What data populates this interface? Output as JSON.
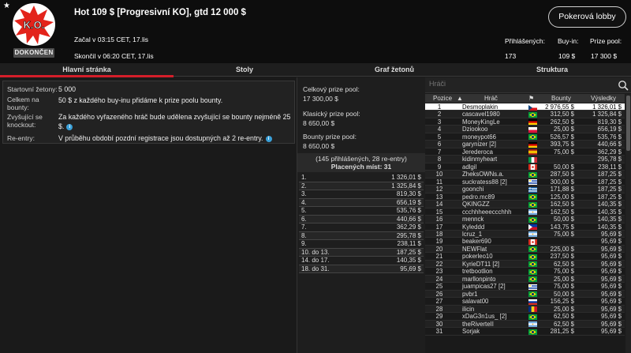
{
  "header": {
    "star": "★",
    "logo_text": "K.O.",
    "status_badge": "DOKONČEN",
    "title": "Hot 109 $ [Progresivní KO], gtd 12 000 $",
    "started": "Začal v 03:15 CET, 17.lis",
    "ended": "Skončil v 06:20 CET, 17.lis",
    "lobby_button": "Pokerová lobby",
    "stats": {
      "entries_label": "Přihlášených:",
      "entries_value": "173",
      "buyin_label": "Buy-in:",
      "buyin_value": "109 $",
      "prize_label": "Prize pool:",
      "prize_value": "17 300 $"
    }
  },
  "tabs": [
    "Hlavní stránka",
    "Stoly",
    "Graf žetonů",
    "Struktura"
  ],
  "active_tab": "Hlavní stránka",
  "colors": {
    "accent": "#d41e2a",
    "info": "#3aa0d8",
    "highlight_row": "#ffffff"
  },
  "info": {
    "starting_chips_label": "Startovní žetony:",
    "starting_chips_value": "5 000",
    "total_bounties_label": "Celkem na bounty:",
    "total_bounties_value": "50 $ z každého buy-inu přidáme k prize poolu bounty.",
    "progressive_label": "Zvyšující se knockout:",
    "progressive_value": "Za každého vyřazeného hráč bude udělena zvyšující se bounty nejméně 25 $.",
    "reentry_label": "Re-entry:",
    "reentry_value": "V průběhu období pozdní registrace jsou dostupných až 2 re-entry."
  },
  "prize_pool": {
    "total_label": "Celkový prize pool:",
    "total_value": "17 300,00 $",
    "classic_label": "Klasický prize pool:",
    "classic_value": "8 650,00 $",
    "bounty_label": "Bounty prize pool:",
    "bounty_value": "8 650,00 $",
    "summary_line": "(145 přihlášených, 28 re-entry)",
    "paid_places": "Placených míst: 31",
    "places": [
      {
        "place": "1.",
        "prize": "1 326,01 $"
      },
      {
        "place": "2.",
        "prize": "1 325,84 $"
      },
      {
        "place": "3.",
        "prize": "819,30 $"
      },
      {
        "place": "4.",
        "prize": "656,19 $"
      },
      {
        "place": "5.",
        "prize": "535,76 $"
      },
      {
        "place": "6.",
        "prize": "440,66 $"
      },
      {
        "place": "7.",
        "prize": "362,29 $"
      },
      {
        "place": "8.",
        "prize": "295,78 $"
      },
      {
        "place": "9.",
        "prize": "238,11 $"
      },
      {
        "place": "10. do 13.",
        "prize": "187,25 $"
      },
      {
        "place": "14. do 17.",
        "prize": "140,35 $"
      },
      {
        "place": "18. do 31.",
        "prize": "95,69 $"
      }
    ]
  },
  "players": {
    "search_placeholder": "Hráči",
    "columns": {
      "position": "Pozice",
      "player": "Hráč",
      "bounty": "Bounty",
      "result": "Výsledky"
    },
    "rows": [
      {
        "pos": "1",
        "name": "Desmoplakin",
        "flag": "cz",
        "bounty": "2 976,55 $",
        "result": "1 326,01 $"
      },
      {
        "pos": "2",
        "name": "cascavel1980",
        "flag": "br",
        "bounty": "312,50 $",
        "result": "1 325,84 $"
      },
      {
        "pos": "3",
        "name": "MoneyKingLe",
        "flag": "de",
        "bounty": "262,50 $",
        "result": "819,30 $"
      },
      {
        "pos": "4",
        "name": "Dziookoo",
        "flag": "pl",
        "bounty": "25,00 $",
        "result": "656,19 $"
      },
      {
        "pos": "5",
        "name": "moneypot66",
        "flag": "br",
        "bounty": "526,57 $",
        "result": "535,76 $"
      },
      {
        "pos": "6",
        "name": "garynizer [2]",
        "flag": "de",
        "bounty": "393,75 $",
        "result": "440,66 $"
      },
      {
        "pos": "7",
        "name": "Jerederoca",
        "flag": "es",
        "bounty": "75,00 $",
        "result": "362,29 $"
      },
      {
        "pos": "8",
        "name": "kidinmyheart",
        "flag": "it",
        "bounty": "",
        "result": "295,78 $"
      },
      {
        "pos": "9",
        "name": "adlgil",
        "flag": "ca",
        "bounty": "50,00 $",
        "result": "238,11 $"
      },
      {
        "pos": "10",
        "name": "ZheksOWNs.a.",
        "flag": "br",
        "bounty": "287,50 $",
        "result": "187,25 $"
      },
      {
        "pos": "11",
        "name": "suckratess88 [2]",
        "flag": "uy",
        "bounty": "300,00 $",
        "result": "187,25 $"
      },
      {
        "pos": "12",
        "name": "goonchi",
        "flag": "gr",
        "bounty": "171,88 $",
        "result": "187,25 $"
      },
      {
        "pos": "13",
        "name": "pedro.mc89",
        "flag": "br",
        "bounty": "125,00 $",
        "result": "187,25 $"
      },
      {
        "pos": "14",
        "name": "QKINGZZ",
        "flag": "br",
        "bounty": "162,50 $",
        "result": "140,35 $"
      },
      {
        "pos": "15",
        "name": "ccchhheeeccchhh",
        "flag": "ar",
        "bounty": "162,50 $",
        "result": "140,35 $"
      },
      {
        "pos": "16",
        "name": "mennck",
        "flag": "br",
        "bounty": "50,00 $",
        "result": "140,35 $"
      },
      {
        "pos": "17",
        "name": "Kyleddd",
        "flag": "ph",
        "bounty": "143,75 $",
        "result": "140,35 $"
      },
      {
        "pos": "18",
        "name": "lcruz_1",
        "flag": "ar",
        "bounty": "75,00 $",
        "result": "95,69 $"
      },
      {
        "pos": "19",
        "name": "beaker690",
        "flag": "ca",
        "bounty": "",
        "result": "95,69 $"
      },
      {
        "pos": "20",
        "name": "NEWFlat",
        "flag": "br",
        "bounty": "225,00 $",
        "result": "95,69 $"
      },
      {
        "pos": "21",
        "name": "pokerleo10",
        "flag": "br",
        "bounty": "237,50 $",
        "result": "95,69 $"
      },
      {
        "pos": "22",
        "name": "KyrieDT11 [2]",
        "flag": "br",
        "bounty": "62,50 $",
        "result": "95,69 $"
      },
      {
        "pos": "23",
        "name": "tretbootlion",
        "flag": "br",
        "bounty": "75,00 $",
        "result": "95,69 $"
      },
      {
        "pos": "24",
        "name": "marllonpinto",
        "flag": "br",
        "bounty": "25,00 $",
        "result": "95,69 $"
      },
      {
        "pos": "25",
        "name": "juampicas27 [2]",
        "flag": "uy",
        "bounty": "75,00 $",
        "result": "95,69 $"
      },
      {
        "pos": "26",
        "name": "pvbr1",
        "flag": "br",
        "bounty": "50,00 $",
        "result": "95,69 $"
      },
      {
        "pos": "27",
        "name": "salavat00",
        "flag": "ru",
        "bounty": "156,25 $",
        "result": "95,69 $"
      },
      {
        "pos": "28",
        "name": "ilicin",
        "flag": "ro",
        "bounty": "25,00 $",
        "result": "95,69 $"
      },
      {
        "pos": "29",
        "name": "xDaG3n1us_ [2]",
        "flag": "br",
        "bounty": "62,50 $",
        "result": "95,69 $"
      },
      {
        "pos": "30",
        "name": "theRiverteII",
        "flag": "ar",
        "bounty": "62,50 $",
        "result": "95,69 $"
      },
      {
        "pos": "31",
        "name": "Sorjak",
        "flag": "br",
        "bounty": "281,25 $",
        "result": "95,69 $"
      }
    ]
  }
}
